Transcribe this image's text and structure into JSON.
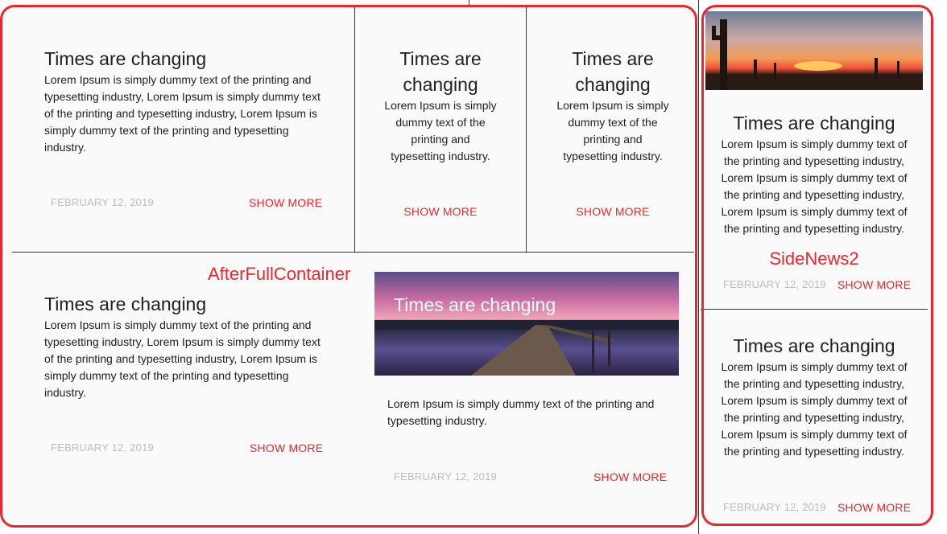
{
  "colors": {
    "accent": "#f0252b",
    "date": "#bdbdbd",
    "text": "#212121",
    "card_bg": "#fafafa"
  },
  "cards": [
    {
      "title": "Times are changing",
      "body": "Lorem Ipsum is simply dummy text of the printing and typesetting industry, Lorem Ipsum is simply dummy text of the printing and typesetting industry, Lorem Ipsum is simply dummy text of the printing and typesetting industry.",
      "date": "FEBRUARY 12, 2019",
      "more": "SHOW MORE"
    },
    {
      "title": "Times are changing",
      "body": "Lorem Ipsum is simply dummy text of the printing and typesetting industry.",
      "more": "SHOW MORE"
    },
    {
      "title": "Times are changing",
      "body": "Lorem Ipsum is simply dummy text of the printing and typesetting industry.",
      "more": "SHOW MORE"
    },
    {
      "title": "Times are changing",
      "body": "Lorem Ipsum is simply dummy text of the printing and typesetting industry, Lorem Ipsum is simply dummy text of the printing and typesetting industry, Lorem Ipsum is simply dummy text of the printing and typesetting industry.",
      "date": "FEBRUARY 12, 2019",
      "more": "SHOW MORE"
    },
    {
      "title": "Times are changing",
      "body": "Lorem Ipsum is simply dummy text of the printing and typesetting industry.",
      "date": "FEBRUARY 12, 2019",
      "more": "SHOW MORE"
    }
  ],
  "after_full_label": "AfterFullContainer",
  "side": [
    {
      "title": "Times are changing",
      "body": "Lorem Ipsum is simply dummy text of the printing and typesetting industry, Lorem Ipsum is simply dummy text of the printing and typesetting industry, Lorem Ipsum is simply dummy text of the printing and typesetting industry.",
      "label": "SideNews2",
      "date": "FEBRUARY 12, 2019",
      "more": "SHOW MORE"
    },
    {
      "title": "Times are changing",
      "body": "Lorem Ipsum is simply dummy text of the printing and typesetting industry, Lorem Ipsum is simply dummy text of the printing and typesetting industry, Lorem Ipsum is simply dummy text of the printing and typesetting industry.",
      "date": "FEBRUARY 12, 2019",
      "more": "SHOW MORE"
    }
  ]
}
